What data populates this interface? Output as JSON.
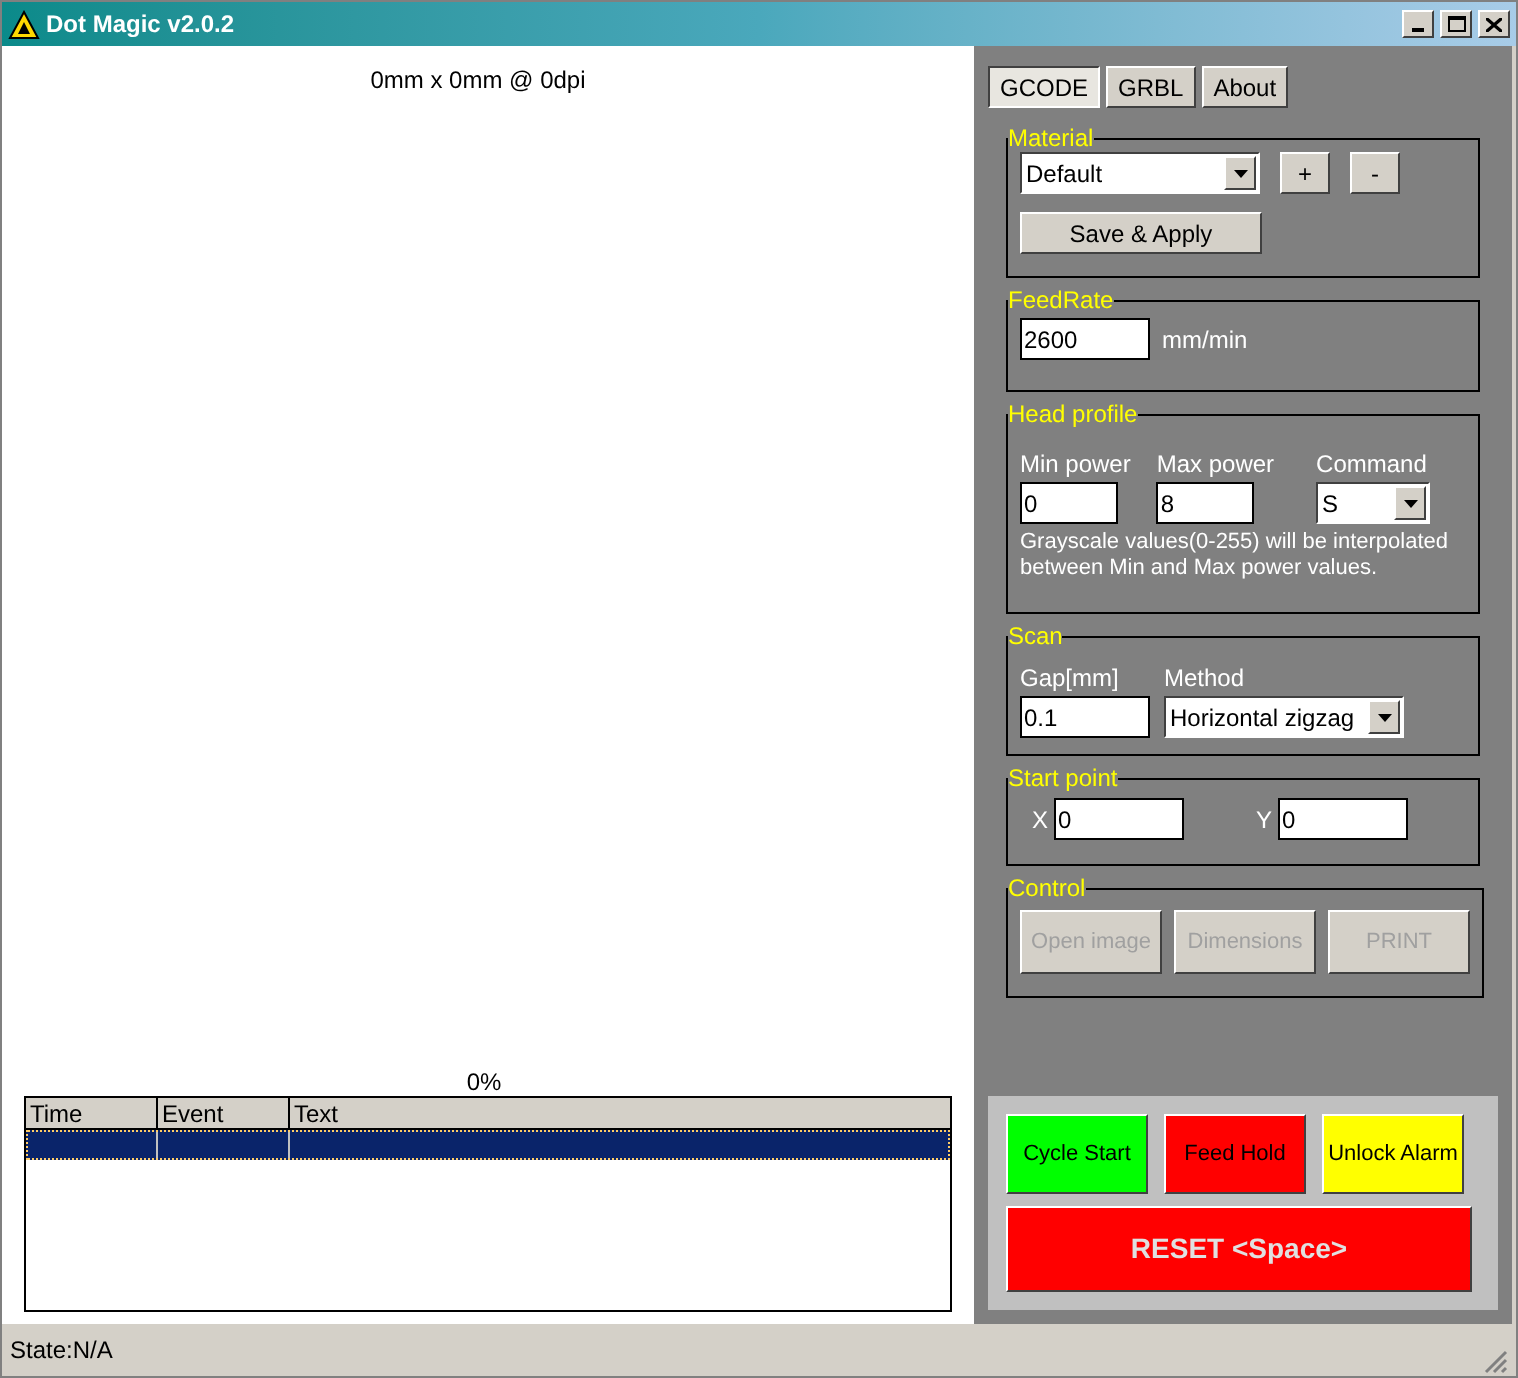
{
  "window": {
    "title": "Dot Magic v2.0.2"
  },
  "canvas": {
    "caption": "0mm x 0mm @ 0dpi",
    "progress": "0%"
  },
  "log": {
    "columns": [
      "Time",
      "Event",
      "Text"
    ],
    "rows": [
      {
        "selected": true
      }
    ]
  },
  "tabs": [
    {
      "label": "GCODE",
      "selected": true
    },
    {
      "label": "GRBL",
      "selected": false
    },
    {
      "label": "About",
      "selected": false
    }
  ],
  "material": {
    "legend": "Material",
    "value": "Default",
    "buttons": [
      "+",
      "-"
    ],
    "save": "Save & Apply"
  },
  "feedrate": {
    "legend": "FeedRate",
    "value": "2600",
    "unit": "mm/min"
  },
  "head_profile": {
    "legend": "Head profile",
    "min_label": "Min power",
    "min_value": "0",
    "max_label": "Max power",
    "max_value": "8",
    "command_label": "Command",
    "command_value": "S",
    "note": "Grayscale values(0-255) will be interpolated between Min and Max power values."
  },
  "scan": {
    "legend": "Scan",
    "gap_label": "Gap[mm]",
    "gap_value": "0.1",
    "method_label": "Method",
    "method_value": "Horizontal zigzag"
  },
  "start_point": {
    "legend": "Start point",
    "x_label": "X",
    "x_value": "0",
    "y_label": "Y",
    "y_value": "0"
  },
  "control": {
    "legend": "Control",
    "buttons": [
      {
        "label": "Open image",
        "disabled": true
      },
      {
        "label": "Dimensions",
        "disabled": true
      },
      {
        "label": "PRINT",
        "disabled": true
      }
    ]
  },
  "machine_buttons": [
    {
      "label": "Cycle Start",
      "color": "#00ff00"
    },
    {
      "label": "Feed Hold",
      "color": "#ff0000"
    },
    {
      "label": "Unlock Alarm",
      "color": "#ffff00"
    }
  ],
  "reset": {
    "label": "RESET <Space>",
    "color": "#ff0000"
  },
  "status_bar": {
    "state": "State:N/A"
  }
}
